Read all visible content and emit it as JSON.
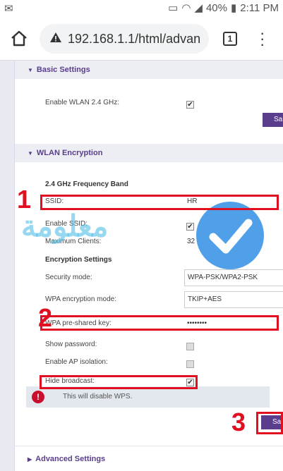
{
  "status_bar": {
    "battery": "40%",
    "time": "2:11 PM"
  },
  "browser": {
    "url": "192.168.1.1/html/advan",
    "tab_count": "1"
  },
  "basic_settings": {
    "title": "Basic Settings",
    "enable_wlan_label": "Enable WLAN 2.4 GHz:",
    "enable_wlan_checked": true,
    "save_label": "Sa"
  },
  "wlan_encryption": {
    "title": "WLAN Encryption",
    "band_title": "2.4 GHz Frequency Band",
    "ssid_label": "SSID:",
    "ssid_value": "HR",
    "enable_ssid_label": "Enable SSID:",
    "enable_ssid_checked": true,
    "max_clients_label": "Maximum Clients:",
    "max_clients_value": "32",
    "encryption_settings_title": "Encryption Settings",
    "security_mode_label": "Security mode:",
    "security_mode_value": "WPA-PSK/WPA2-PSK",
    "wpa_encryption_mode_label": "WPA encryption mode:",
    "wpa_encryption_mode_value": "TKIP+AES",
    "wpa_key_label": "WPA pre-shared key:",
    "wpa_key_value": "••••••••",
    "show_password_label": "Show password:",
    "show_password_checked": false,
    "ap_isolation_label": "Enable AP isolation:",
    "ap_isolation_checked": false,
    "hide_broadcast_label": "Hide broadcast:",
    "hide_broadcast_checked": true,
    "warning_text": "This will disable WPS.",
    "save_label": "Sa"
  },
  "advanced_settings": {
    "title": "Advanced Settings"
  },
  "annotations": {
    "step1": "1",
    "step2": "2",
    "step3": "3"
  },
  "watermark": {
    "text": "معلومة"
  },
  "colors": {
    "accent": "#5a3d8c",
    "highlight": "#e01020",
    "warning": "#c8102e"
  }
}
